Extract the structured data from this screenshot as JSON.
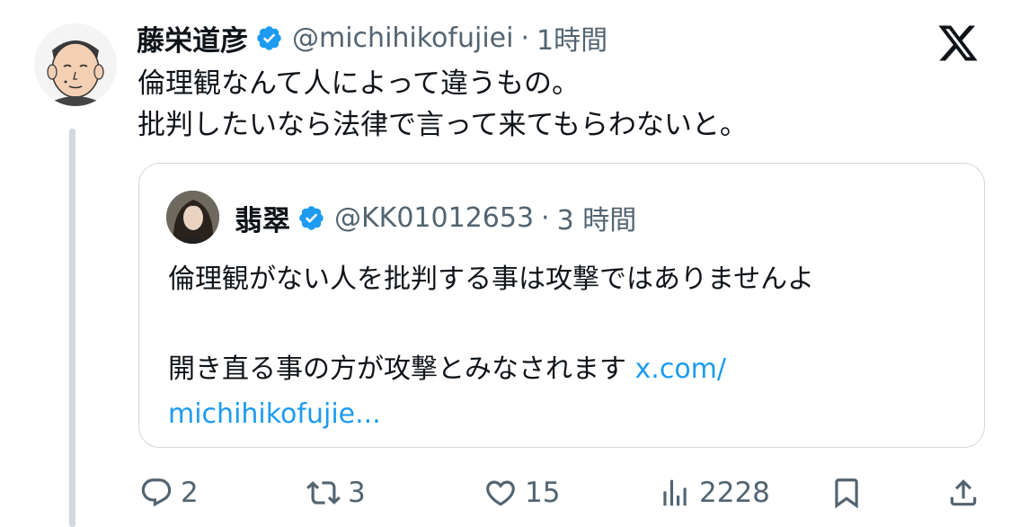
{
  "tweet": {
    "author_name": "藤栄道彦",
    "handle": "@michihikofujiei",
    "separator": "·",
    "time": "1時間",
    "text_lines": [
      "倫理観なんて人によって違うもの。",
      "批判したいなら法律で言って来てもらわないと。"
    ]
  },
  "quote": {
    "author_name": "翡翠",
    "handle": "@KK01012653",
    "separator": "·",
    "time": "3 時間",
    "line1": "倫理観がない人を批判する事は攻撃ではありませんよ",
    "line2": "開き直る事の方が攻撃とみなされます",
    "link_part1": "x.com/",
    "link_part2": "michihikofujie..."
  },
  "actions": {
    "replies": "2",
    "retweets": "3",
    "likes": "15",
    "views": "2228"
  },
  "colors": {
    "text": "#0f1419",
    "secondary": "#536471",
    "verified": "#1d9bf0",
    "link": "#1d9bf0",
    "border": "#cfd9de"
  },
  "icons": [
    "verified-badge-icon",
    "x-logo-icon",
    "reply-icon",
    "retweet-icon",
    "like-icon",
    "views-icon",
    "bookmark-icon",
    "share-icon"
  ]
}
